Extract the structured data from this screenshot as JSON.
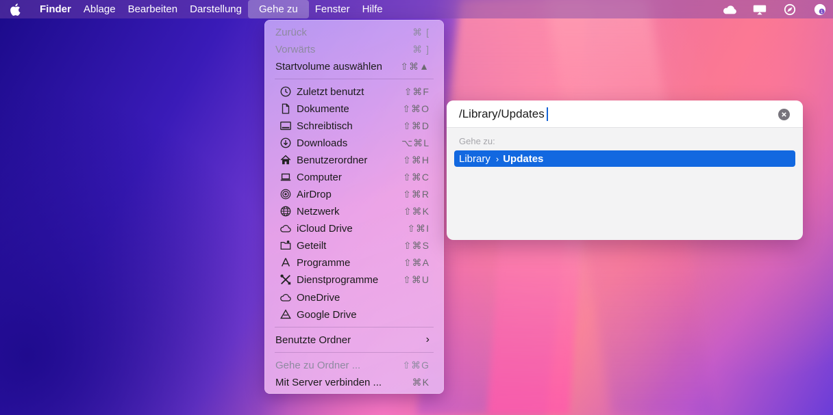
{
  "menubar": {
    "app": "Finder",
    "items": [
      "Ablage",
      "Bearbeiten",
      "Darstellung",
      "Gehe zu",
      "Fenster",
      "Hilfe"
    ],
    "active_item": "Gehe zu",
    "status_icons": [
      "onedrive-cloud-icon",
      "display-mirror-icon",
      "compass-icon",
      "user-badge-icon"
    ]
  },
  "go_menu": {
    "back": {
      "label": "Zurück",
      "shortcut": "⌘ ["
    },
    "forward": {
      "label": "Vorwärts",
      "shortcut": "⌘ ]"
    },
    "startup": {
      "label": "Startvolume auswählen",
      "shortcut": "⇧⌘▲"
    },
    "places": [
      {
        "label": "Zuletzt benutzt",
        "shortcut": "⇧⌘F",
        "icon": "clock-icon"
      },
      {
        "label": "Dokumente",
        "shortcut": "⇧⌘O",
        "icon": "document-icon"
      },
      {
        "label": "Schreibtisch",
        "shortcut": "⇧⌘D",
        "icon": "desktop-icon"
      },
      {
        "label": "Downloads",
        "shortcut": "⌥⌘L",
        "icon": "download-icon"
      },
      {
        "label": "Benutzerordner",
        "shortcut": "⇧⌘H",
        "icon": "home-icon"
      },
      {
        "label": "Computer",
        "shortcut": "⇧⌘C",
        "icon": "laptop-icon"
      },
      {
        "label": "AirDrop",
        "shortcut": "⇧⌘R",
        "icon": "airdrop-icon"
      },
      {
        "label": "Netzwerk",
        "shortcut": "⇧⌘K",
        "icon": "globe-icon"
      },
      {
        "label": "iCloud Drive",
        "shortcut": "⇧⌘I",
        "icon": "cloud-icon"
      },
      {
        "label": "Geteilt",
        "shortcut": "⇧⌘S",
        "icon": "shared-folder-icon"
      },
      {
        "label": "Programme",
        "shortcut": "⇧⌘A",
        "icon": "apps-icon"
      },
      {
        "label": "Dienstprogramme",
        "shortcut": "⇧⌘U",
        "icon": "tools-icon"
      },
      {
        "label": "OneDrive",
        "shortcut": "",
        "icon": "cloud-icon"
      },
      {
        "label": "Google Drive",
        "shortcut": "",
        "icon": "google-drive-icon"
      }
    ],
    "recent_folders": {
      "label": "Benutzte Ordner"
    },
    "goto_folder": {
      "label": "Gehe zu Ordner ...",
      "shortcut": "⇧⌘G"
    },
    "connect_server": {
      "label": "Mit Server verbinden ...",
      "shortcut": "⌘K"
    }
  },
  "goto_dialog": {
    "path_value": "/Library/Updates",
    "section_label": "Gehe zu:",
    "suggestion": {
      "parent": "Library",
      "separator": "›",
      "leaf": "Updates"
    }
  }
}
